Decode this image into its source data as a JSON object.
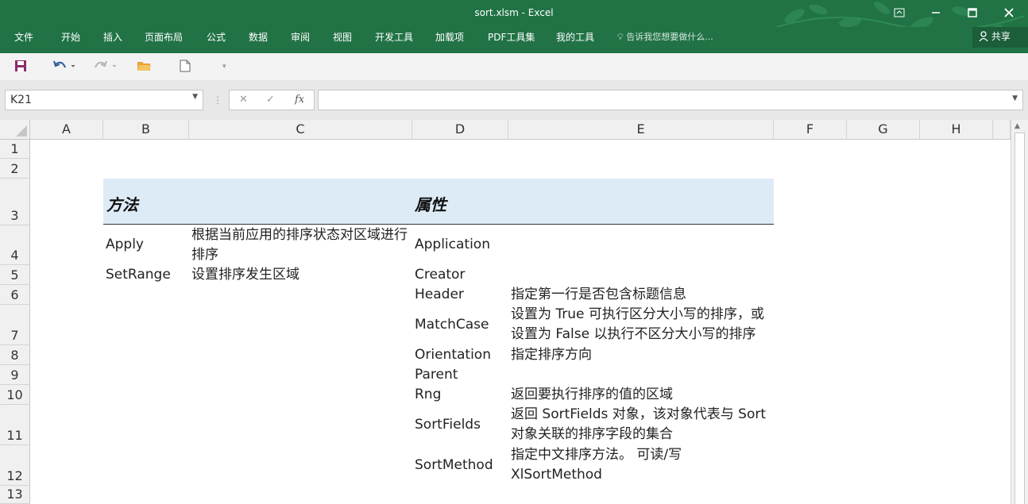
{
  "window": {
    "title": "sort.xlsm - Excel"
  },
  "ribbon": {
    "tabs": [
      "文件",
      "开始",
      "插入",
      "页面布局",
      "公式",
      "数据",
      "审阅",
      "视图",
      "开发工具",
      "加载项",
      "PDF工具集",
      "我的工具"
    ],
    "tell_me": "告诉我您想要做什么...",
    "share": "共享"
  },
  "formula_bar": {
    "name_box": "K21",
    "fx_label": "fx",
    "formula": ""
  },
  "columns": [
    "A",
    "B",
    "C",
    "D",
    "E",
    "F",
    "G",
    "H"
  ],
  "rows": [
    "1",
    "2",
    "3",
    "4",
    "5",
    "6",
    "7",
    "8",
    "9",
    "10",
    "11",
    "12",
    "13"
  ],
  "sheet": {
    "header_methods": "方法",
    "header_properties": "属性",
    "methods": [
      {
        "name": "Apply",
        "desc": "根据当前应用的排序状态对区域进行排序"
      },
      {
        "name": "SetRange",
        "desc": "设置排序发生区域"
      }
    ],
    "properties": [
      {
        "name": "Application",
        "desc": ""
      },
      {
        "name": "Creator",
        "desc": ""
      },
      {
        "name": "Header",
        "desc": "指定第一行是否包含标题信息"
      },
      {
        "name": "MatchCase",
        "desc": "设置为 True 可执行区分大小写的排序，或设置为 False 以执行不区分大小写的排序"
      },
      {
        "name": "Orientation",
        "desc": "指定排序方向"
      },
      {
        "name": "Parent",
        "desc": ""
      },
      {
        "name": "Rng",
        "desc": "返回要执行排序的值的区域"
      },
      {
        "name": "SortFields",
        "desc": "返回 SortFields 对象，该对象代表与 Sort 对象关联的排序字段的集合"
      },
      {
        "name": "SortMethod",
        "desc": "指定中文排序方法。 可读/写 XlSortMethod"
      }
    ]
  }
}
